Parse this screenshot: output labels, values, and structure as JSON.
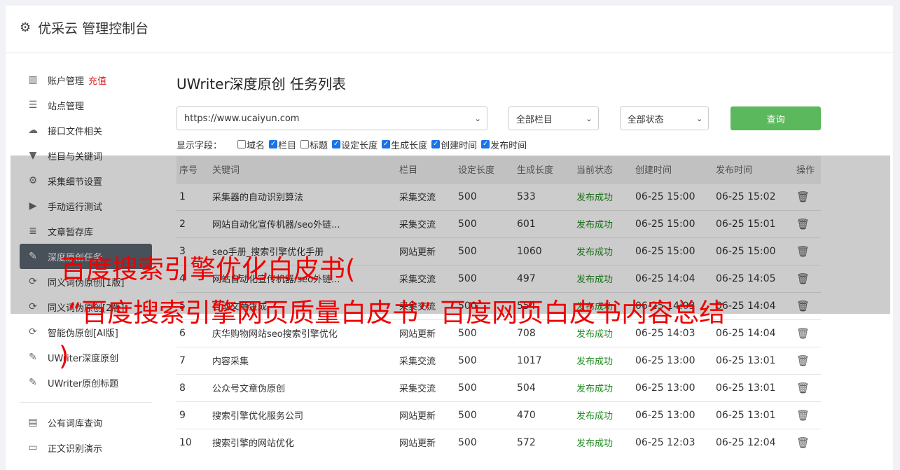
{
  "header": {
    "title": "优采云 管理控制台",
    "icon": "gear-icon"
  },
  "sidebar": {
    "group1": [
      {
        "label": "账户管理",
        "tag": "充值",
        "icon": "bar-chart-icon"
      },
      {
        "label": "站点管理",
        "icon": "server-icon"
      },
      {
        "label": "接口文件相关",
        "icon": "cloud-upload-icon"
      },
      {
        "label": "栏目与关键词",
        "icon": "filter-icon"
      },
      {
        "label": "采集细节设置",
        "icon": "cogs-icon"
      },
      {
        "label": "手动运行测试",
        "icon": "play-icon"
      },
      {
        "label": "文章暂存库",
        "icon": "database-icon"
      },
      {
        "label": "深度原创任务",
        "icon": "edit-icon",
        "active": true
      },
      {
        "label": "同义词伪原创[1版]",
        "icon": "refresh-icon"
      },
      {
        "label": "同义词伪原创[2版]",
        "icon": "refresh-icon"
      },
      {
        "label": "智能伪原创[AI版]",
        "icon": "refresh-icon"
      },
      {
        "label": "UWriter深度原创",
        "icon": "edit-icon"
      },
      {
        "label": "UWriter原创标题",
        "icon": "edit-icon"
      }
    ],
    "group2": [
      {
        "label": "公有词库查询",
        "icon": "book-icon"
      },
      {
        "label": "正文识别演示",
        "icon": "monitor-icon"
      }
    ]
  },
  "main": {
    "title": "UWriter深度原创 任务列表",
    "filters": {
      "site": "https://www.ucaiyun.com",
      "column": "全部栏目",
      "status": "全部状态",
      "query_label": "查询"
    },
    "fields": {
      "label": "显示字段：",
      "items": [
        {
          "label": "域名",
          "checked": false
        },
        {
          "label": "栏目",
          "checked": true
        },
        {
          "label": "标题",
          "checked": false
        },
        {
          "label": "设定长度",
          "checked": true
        },
        {
          "label": "生成长度",
          "checked": true
        },
        {
          "label": "创建时间",
          "checked": true
        },
        {
          "label": "发布时间",
          "checked": true
        }
      ]
    },
    "table": {
      "headers": [
        "序号",
        "关键词",
        "栏目",
        "设定长度",
        "生成长度",
        "当前状态",
        "创建时间",
        "发布时间",
        "操作"
      ],
      "rows": [
        [
          "1",
          "采集器的自动识别算法",
          "采集交流",
          "500",
          "533",
          "发布成功",
          "06-25 15:00",
          "06-25 15:02"
        ],
        [
          "2",
          "网站自动化宣传机器/seo外链...",
          "采集交流",
          "500",
          "601",
          "发布成功",
          "06-25 15:00",
          "06-25 15:01"
        ],
        [
          "3",
          "seo手册_搜索引擎优化手册",
          "网站更新",
          "500",
          "1060",
          "发布成功",
          "06-25 15:00",
          "06-25 15:00"
        ],
        [
          "4",
          "网站自动化宣传机器/seo外链...",
          "采集交流",
          "500",
          "497",
          "发布成功",
          "06-25 14:04",
          "06-25 14:05"
        ],
        [
          "5",
          "自动文章生成",
          "采集交流",
          "500",
          "554",
          "发布成功",
          "06-25 14:03",
          "06-25 14:04"
        ],
        [
          "6",
          "庆华购物网站seo搜索引擎优化",
          "网站更新",
          "500",
          "708",
          "发布成功",
          "06-25 14:03",
          "06-25 14:04"
        ],
        [
          "7",
          "内容采集",
          "采集交流",
          "500",
          "1017",
          "发布成功",
          "06-25 13:00",
          "06-25 13:01"
        ],
        [
          "8",
          "公众号文章伪原创",
          "采集交流",
          "500",
          "504",
          "发布成功",
          "06-25 13:00",
          "06-25 13:01"
        ],
        [
          "9",
          "搜索引擎优化服务公司",
          "网站更新",
          "500",
          "470",
          "发布成功",
          "06-25 13:00",
          "06-25 13:01"
        ],
        [
          "10",
          "搜索引擎的网站优化",
          "网站更新",
          "500",
          "572",
          "发布成功",
          "06-25 12:03",
          "06-25 12:04"
        ]
      ]
    }
  },
  "overlay": {
    "line1": "百度搜索引擎优化白皮书(",
    "line2": "“百度搜索引擎网页质量白皮书” 百度网页白皮书内容总结",
    "line3": ")"
  },
  "colors": {
    "accent_green": "#5cb85c",
    "status_green": "#1f8a1f",
    "active_nav": "#5a6470",
    "overlay_red": "#e00000"
  }
}
